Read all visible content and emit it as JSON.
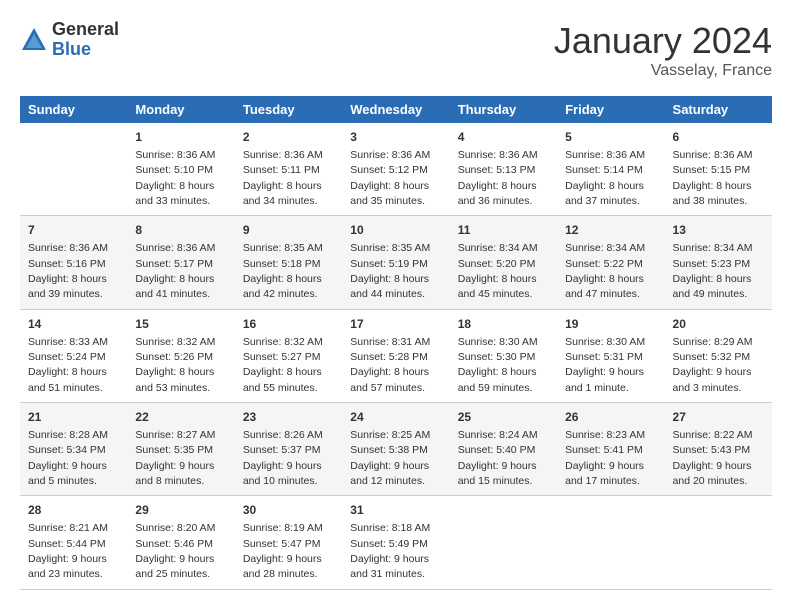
{
  "header": {
    "logo_general": "General",
    "logo_blue": "Blue",
    "month_title": "January 2024",
    "subtitle": "Vasselay, France"
  },
  "days_of_week": [
    "Sunday",
    "Monday",
    "Tuesday",
    "Wednesday",
    "Thursday",
    "Friday",
    "Saturday"
  ],
  "weeks": [
    [
      {
        "num": "",
        "sunrise": "",
        "sunset": "",
        "daylight": ""
      },
      {
        "num": "1",
        "sunrise": "Sunrise: 8:36 AM",
        "sunset": "Sunset: 5:10 PM",
        "daylight": "Daylight: 8 hours and 33 minutes."
      },
      {
        "num": "2",
        "sunrise": "Sunrise: 8:36 AM",
        "sunset": "Sunset: 5:11 PM",
        "daylight": "Daylight: 8 hours and 34 minutes."
      },
      {
        "num": "3",
        "sunrise": "Sunrise: 8:36 AM",
        "sunset": "Sunset: 5:12 PM",
        "daylight": "Daylight: 8 hours and 35 minutes."
      },
      {
        "num": "4",
        "sunrise": "Sunrise: 8:36 AM",
        "sunset": "Sunset: 5:13 PM",
        "daylight": "Daylight: 8 hours and 36 minutes."
      },
      {
        "num": "5",
        "sunrise": "Sunrise: 8:36 AM",
        "sunset": "Sunset: 5:14 PM",
        "daylight": "Daylight: 8 hours and 37 minutes."
      },
      {
        "num": "6",
        "sunrise": "Sunrise: 8:36 AM",
        "sunset": "Sunset: 5:15 PM",
        "daylight": "Daylight: 8 hours and 38 minutes."
      }
    ],
    [
      {
        "num": "7",
        "sunrise": "Sunrise: 8:36 AM",
        "sunset": "Sunset: 5:16 PM",
        "daylight": "Daylight: 8 hours and 39 minutes."
      },
      {
        "num": "8",
        "sunrise": "Sunrise: 8:36 AM",
        "sunset": "Sunset: 5:17 PM",
        "daylight": "Daylight: 8 hours and 41 minutes."
      },
      {
        "num": "9",
        "sunrise": "Sunrise: 8:35 AM",
        "sunset": "Sunset: 5:18 PM",
        "daylight": "Daylight: 8 hours and 42 minutes."
      },
      {
        "num": "10",
        "sunrise": "Sunrise: 8:35 AM",
        "sunset": "Sunset: 5:19 PM",
        "daylight": "Daylight: 8 hours and 44 minutes."
      },
      {
        "num": "11",
        "sunrise": "Sunrise: 8:34 AM",
        "sunset": "Sunset: 5:20 PM",
        "daylight": "Daylight: 8 hours and 45 minutes."
      },
      {
        "num": "12",
        "sunrise": "Sunrise: 8:34 AM",
        "sunset": "Sunset: 5:22 PM",
        "daylight": "Daylight: 8 hours and 47 minutes."
      },
      {
        "num": "13",
        "sunrise": "Sunrise: 8:34 AM",
        "sunset": "Sunset: 5:23 PM",
        "daylight": "Daylight: 8 hours and 49 minutes."
      }
    ],
    [
      {
        "num": "14",
        "sunrise": "Sunrise: 8:33 AM",
        "sunset": "Sunset: 5:24 PM",
        "daylight": "Daylight: 8 hours and 51 minutes."
      },
      {
        "num": "15",
        "sunrise": "Sunrise: 8:32 AM",
        "sunset": "Sunset: 5:26 PM",
        "daylight": "Daylight: 8 hours and 53 minutes."
      },
      {
        "num": "16",
        "sunrise": "Sunrise: 8:32 AM",
        "sunset": "Sunset: 5:27 PM",
        "daylight": "Daylight: 8 hours and 55 minutes."
      },
      {
        "num": "17",
        "sunrise": "Sunrise: 8:31 AM",
        "sunset": "Sunset: 5:28 PM",
        "daylight": "Daylight: 8 hours and 57 minutes."
      },
      {
        "num": "18",
        "sunrise": "Sunrise: 8:30 AM",
        "sunset": "Sunset: 5:30 PM",
        "daylight": "Daylight: 8 hours and 59 minutes."
      },
      {
        "num": "19",
        "sunrise": "Sunrise: 8:30 AM",
        "sunset": "Sunset: 5:31 PM",
        "daylight": "Daylight: 9 hours and 1 minute."
      },
      {
        "num": "20",
        "sunrise": "Sunrise: 8:29 AM",
        "sunset": "Sunset: 5:32 PM",
        "daylight": "Daylight: 9 hours and 3 minutes."
      }
    ],
    [
      {
        "num": "21",
        "sunrise": "Sunrise: 8:28 AM",
        "sunset": "Sunset: 5:34 PM",
        "daylight": "Daylight: 9 hours and 5 minutes."
      },
      {
        "num": "22",
        "sunrise": "Sunrise: 8:27 AM",
        "sunset": "Sunset: 5:35 PM",
        "daylight": "Daylight: 9 hours and 8 minutes."
      },
      {
        "num": "23",
        "sunrise": "Sunrise: 8:26 AM",
        "sunset": "Sunset: 5:37 PM",
        "daylight": "Daylight: 9 hours and 10 minutes."
      },
      {
        "num": "24",
        "sunrise": "Sunrise: 8:25 AM",
        "sunset": "Sunset: 5:38 PM",
        "daylight": "Daylight: 9 hours and 12 minutes."
      },
      {
        "num": "25",
        "sunrise": "Sunrise: 8:24 AM",
        "sunset": "Sunset: 5:40 PM",
        "daylight": "Daylight: 9 hours and 15 minutes."
      },
      {
        "num": "26",
        "sunrise": "Sunrise: 8:23 AM",
        "sunset": "Sunset: 5:41 PM",
        "daylight": "Daylight: 9 hours and 17 minutes."
      },
      {
        "num": "27",
        "sunrise": "Sunrise: 8:22 AM",
        "sunset": "Sunset: 5:43 PM",
        "daylight": "Daylight: 9 hours and 20 minutes."
      }
    ],
    [
      {
        "num": "28",
        "sunrise": "Sunrise: 8:21 AM",
        "sunset": "Sunset: 5:44 PM",
        "daylight": "Daylight: 9 hours and 23 minutes."
      },
      {
        "num": "29",
        "sunrise": "Sunrise: 8:20 AM",
        "sunset": "Sunset: 5:46 PM",
        "daylight": "Daylight: 9 hours and 25 minutes."
      },
      {
        "num": "30",
        "sunrise": "Sunrise: 8:19 AM",
        "sunset": "Sunset: 5:47 PM",
        "daylight": "Daylight: 9 hours and 28 minutes."
      },
      {
        "num": "31",
        "sunrise": "Sunrise: 8:18 AM",
        "sunset": "Sunset: 5:49 PM",
        "daylight": "Daylight: 9 hours and 31 minutes."
      },
      {
        "num": "",
        "sunrise": "",
        "sunset": "",
        "daylight": ""
      },
      {
        "num": "",
        "sunrise": "",
        "sunset": "",
        "daylight": ""
      },
      {
        "num": "",
        "sunrise": "",
        "sunset": "",
        "daylight": ""
      }
    ]
  ]
}
